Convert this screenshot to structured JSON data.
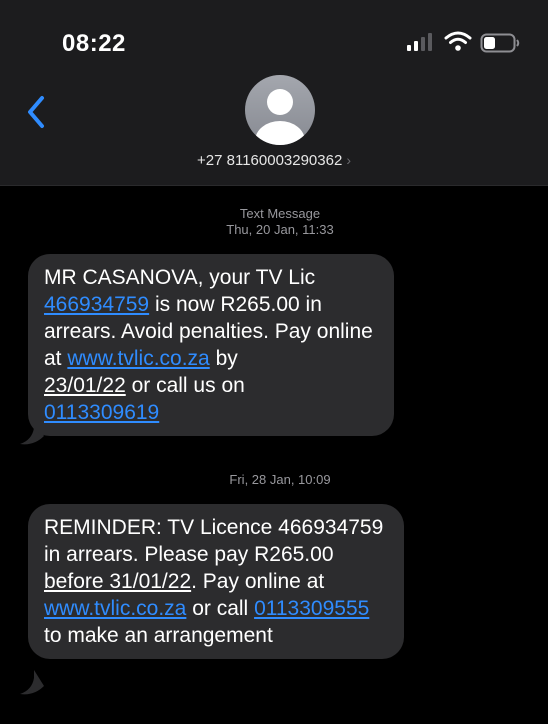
{
  "status_bar": {
    "time": "08:22"
  },
  "header": {
    "contact_number": "+27 81160003290362",
    "chevron": "›"
  },
  "messages": [
    {
      "label": "Text Message",
      "timestamp": "Thu, 20 Jan, 11:33",
      "parts": {
        "p1": "MR CASANOVA, your TV Lic",
        "link_account": "466934759",
        "p2": " is now R265.00 in arrears. Avoid penalties. Pay online at ",
        "link_site": "www.tvlic.co.za",
        "p3": " by",
        "date": "23/01/22",
        "p4": " or call us on",
        "link_phone": "0113309619"
      }
    },
    {
      "timestamp": "Fri, 28 Jan, 10:09",
      "parts": {
        "p1": "REMINDER: TV Licence 466934759 in arrears. Please pay R265.00 ",
        "before": "before 31/01/22",
        "p2": ". Pay online at ",
        "link_site": "www.tvlic.co.za",
        "p3": " or call ",
        "link_phone": "0113309555",
        "p4": " to make an arrangement"
      }
    }
  ],
  "colors": {
    "link": "#2f8cff",
    "bubble": "#2c2c2e",
    "header": "#1c1c1e"
  },
  "icons": [
    "signal-icon",
    "wifi-icon",
    "battery-icon",
    "back-chevron-icon",
    "avatar-icon"
  ]
}
